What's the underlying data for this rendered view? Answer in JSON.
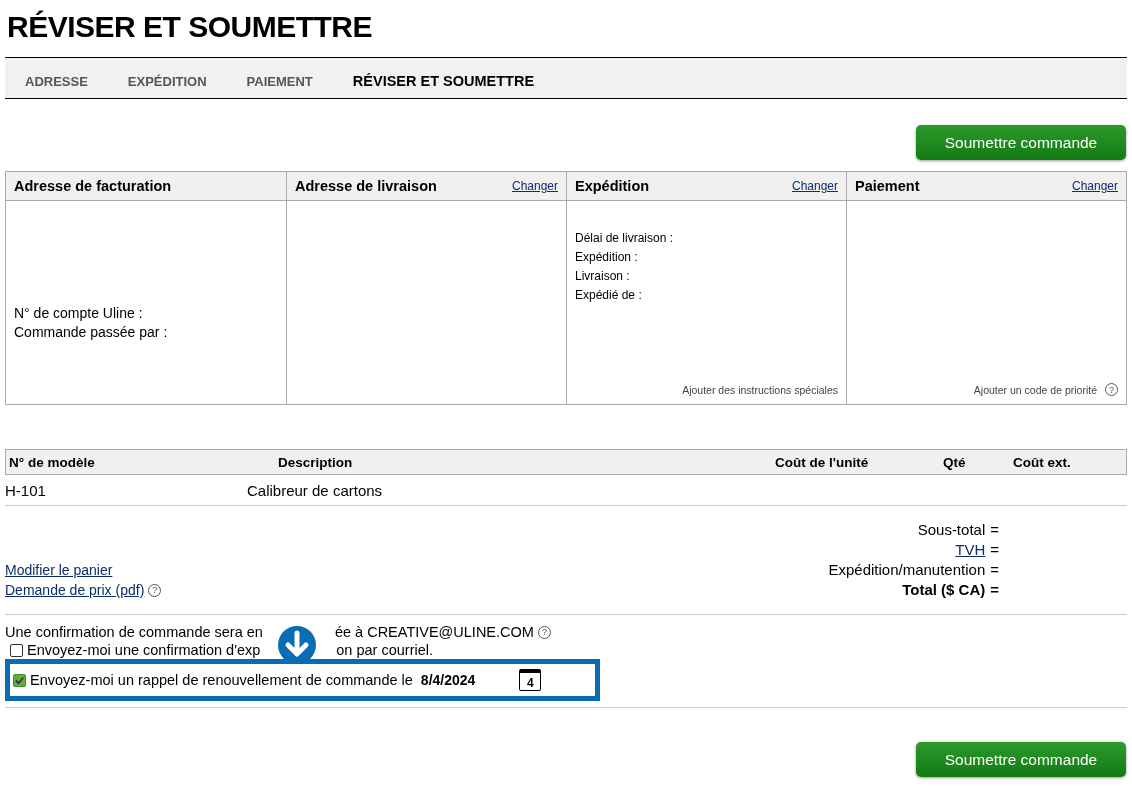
{
  "page": {
    "title": "RÉVISER ET SOUMETTRE"
  },
  "steps": [
    {
      "label": "ADRESSE",
      "selected": false
    },
    {
      "label": "EXPÉDITION",
      "selected": false
    },
    {
      "label": "PAIEMENT",
      "selected": false
    },
    {
      "label": "RÉVISER ET SOUMETTRE",
      "selected": true
    }
  ],
  "top_button": "Soumettre commande",
  "panels": [
    {
      "title": "Adresse de facturation",
      "lines": [
        "N° de compte Uline :",
        "Commande passée par :"
      ]
    },
    {
      "title": "Adresse de livraison",
      "change_link": "Changer"
    },
    {
      "title": "Expédition",
      "change_link": "Changer",
      "lines": [
        "Délai de livraison :",
        "Expédition :",
        "Livraison :",
        "Expédié de :"
      ],
      "footer": {
        "text": "Ajouter des instructions spéciales"
      }
    },
    {
      "title": "Paiement",
      "change_link": "Changer",
      "footer": {
        "text": "Ajouter un code de priorité",
        "help": "?"
      }
    }
  ],
  "table": {
    "columns": [
      "N° de modèle",
      "Description",
      "Coût de l'unité",
      "Qté",
      "Coût ext."
    ],
    "rows": [
      {
        "model": "H-101",
        "description": "Calibreur de cartons"
      }
    ]
  },
  "cart_links": [
    {
      "text": "Modifier le panier"
    },
    {
      "text": "Demande de prix (pdf)",
      "help": "?"
    }
  ],
  "totals": [
    {
      "label": "Sous-total",
      "sign": "=",
      "kind": "plain"
    },
    {
      "label": "TVH",
      "sign": "=",
      "kind": "link"
    },
    {
      "label": "Expédition/manutention",
      "sign": "=",
      "kind": "plain"
    },
    {
      "label": "Total ($ CA)",
      "sign": "=",
      "kind": "bold"
    }
  ],
  "confirmation": {
    "parts": [
      "Une confirmation de commande sera en",
      "ée à CREATIVE@ULINE.COM"
    ],
    "help": "?"
  },
  "options": [
    {
      "parts": [
        "Envoyez-moi une confirmation d'exp",
        "on par courriel."
      ],
      "checked": false,
      "highlighted": false
    },
    {
      "parts": [
        "Envoyez-moi un rappel de renouvellement de commande le"
      ],
      "checked": true,
      "highlighted": true,
      "date": "8/4/2024",
      "calendar_day": "4"
    }
  ],
  "bottom_button": "Soumettre commande"
}
